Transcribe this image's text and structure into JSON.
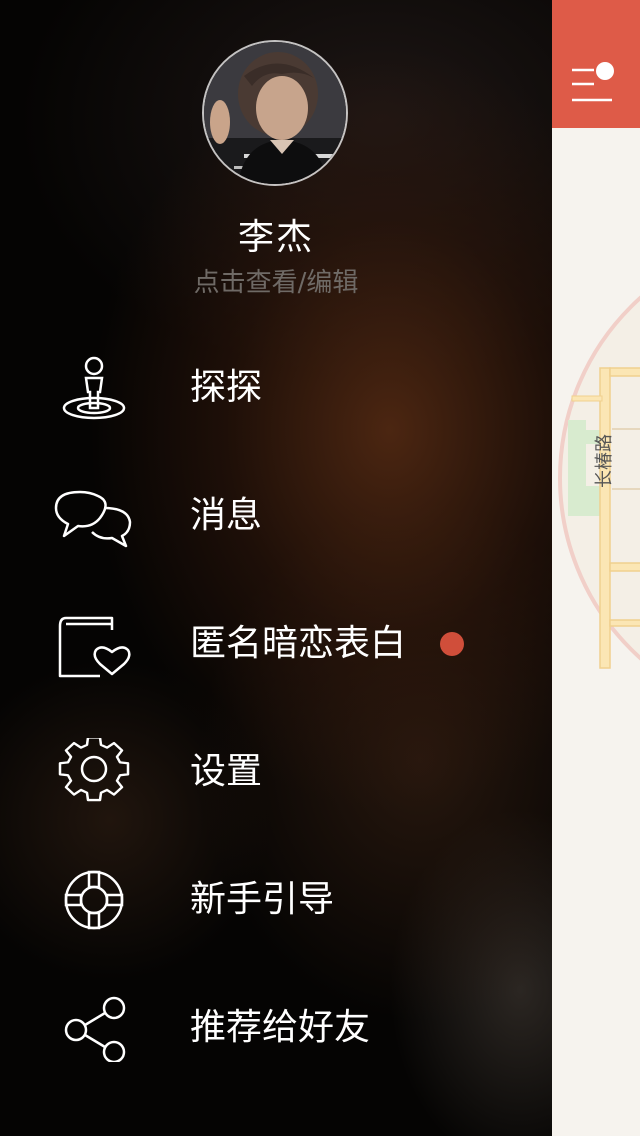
{
  "profile": {
    "name": "李杰",
    "subtitle": "点击查看/编辑"
  },
  "menu": {
    "items": [
      {
        "label": "探探",
        "icon": "explore-person-icon"
      },
      {
        "label": "消息",
        "icon": "chat-bubbles-icon"
      },
      {
        "label": "匿名暗恋表白",
        "icon": "heart-book-icon",
        "badge": "notification-dot"
      },
      {
        "label": "设置",
        "icon": "gear-icon"
      },
      {
        "label": "新手引导",
        "icon": "lifebuoy-icon"
      },
      {
        "label": "推荐给好友",
        "icon": "share-icon"
      }
    ]
  },
  "main": {
    "map_road_label": "长椿路"
  },
  "colors": {
    "accent": "#de5b48",
    "badge": "#d04e3a",
    "subtitle": "#6f6a66",
    "map_bg": "#f6f3ee"
  }
}
